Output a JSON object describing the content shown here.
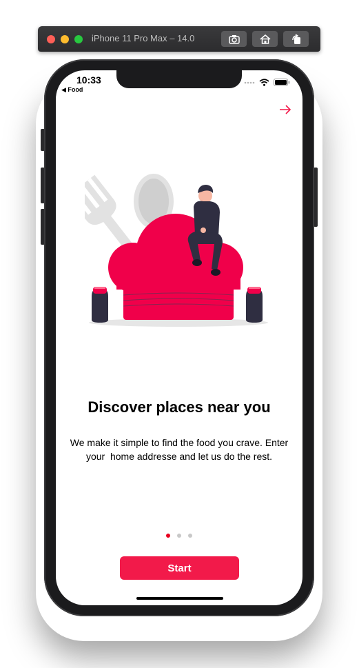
{
  "simulator": {
    "title": "iPhone 11 Pro Max – 14.0",
    "buttons": [
      "screenshot-icon",
      "home-icon",
      "rotate-icon"
    ]
  },
  "status_bar": {
    "time": "10:33",
    "back_app": "◀ Food",
    "icons": [
      "signal-icon",
      "wifi-icon",
      "battery-icon"
    ]
  },
  "onboarding": {
    "next_icon": "arrow-right-icon",
    "title": "Discover places near you",
    "description": "We make it simple to find the food you crave. Enter your  home addresse and let us do the rest.",
    "page_count": 3,
    "active_page": 1,
    "start_label": "Start"
  },
  "colors": {
    "accent": "#f21a4a",
    "active_dot": "#e8001f",
    "inactive_dot": "#c8c8c8"
  }
}
